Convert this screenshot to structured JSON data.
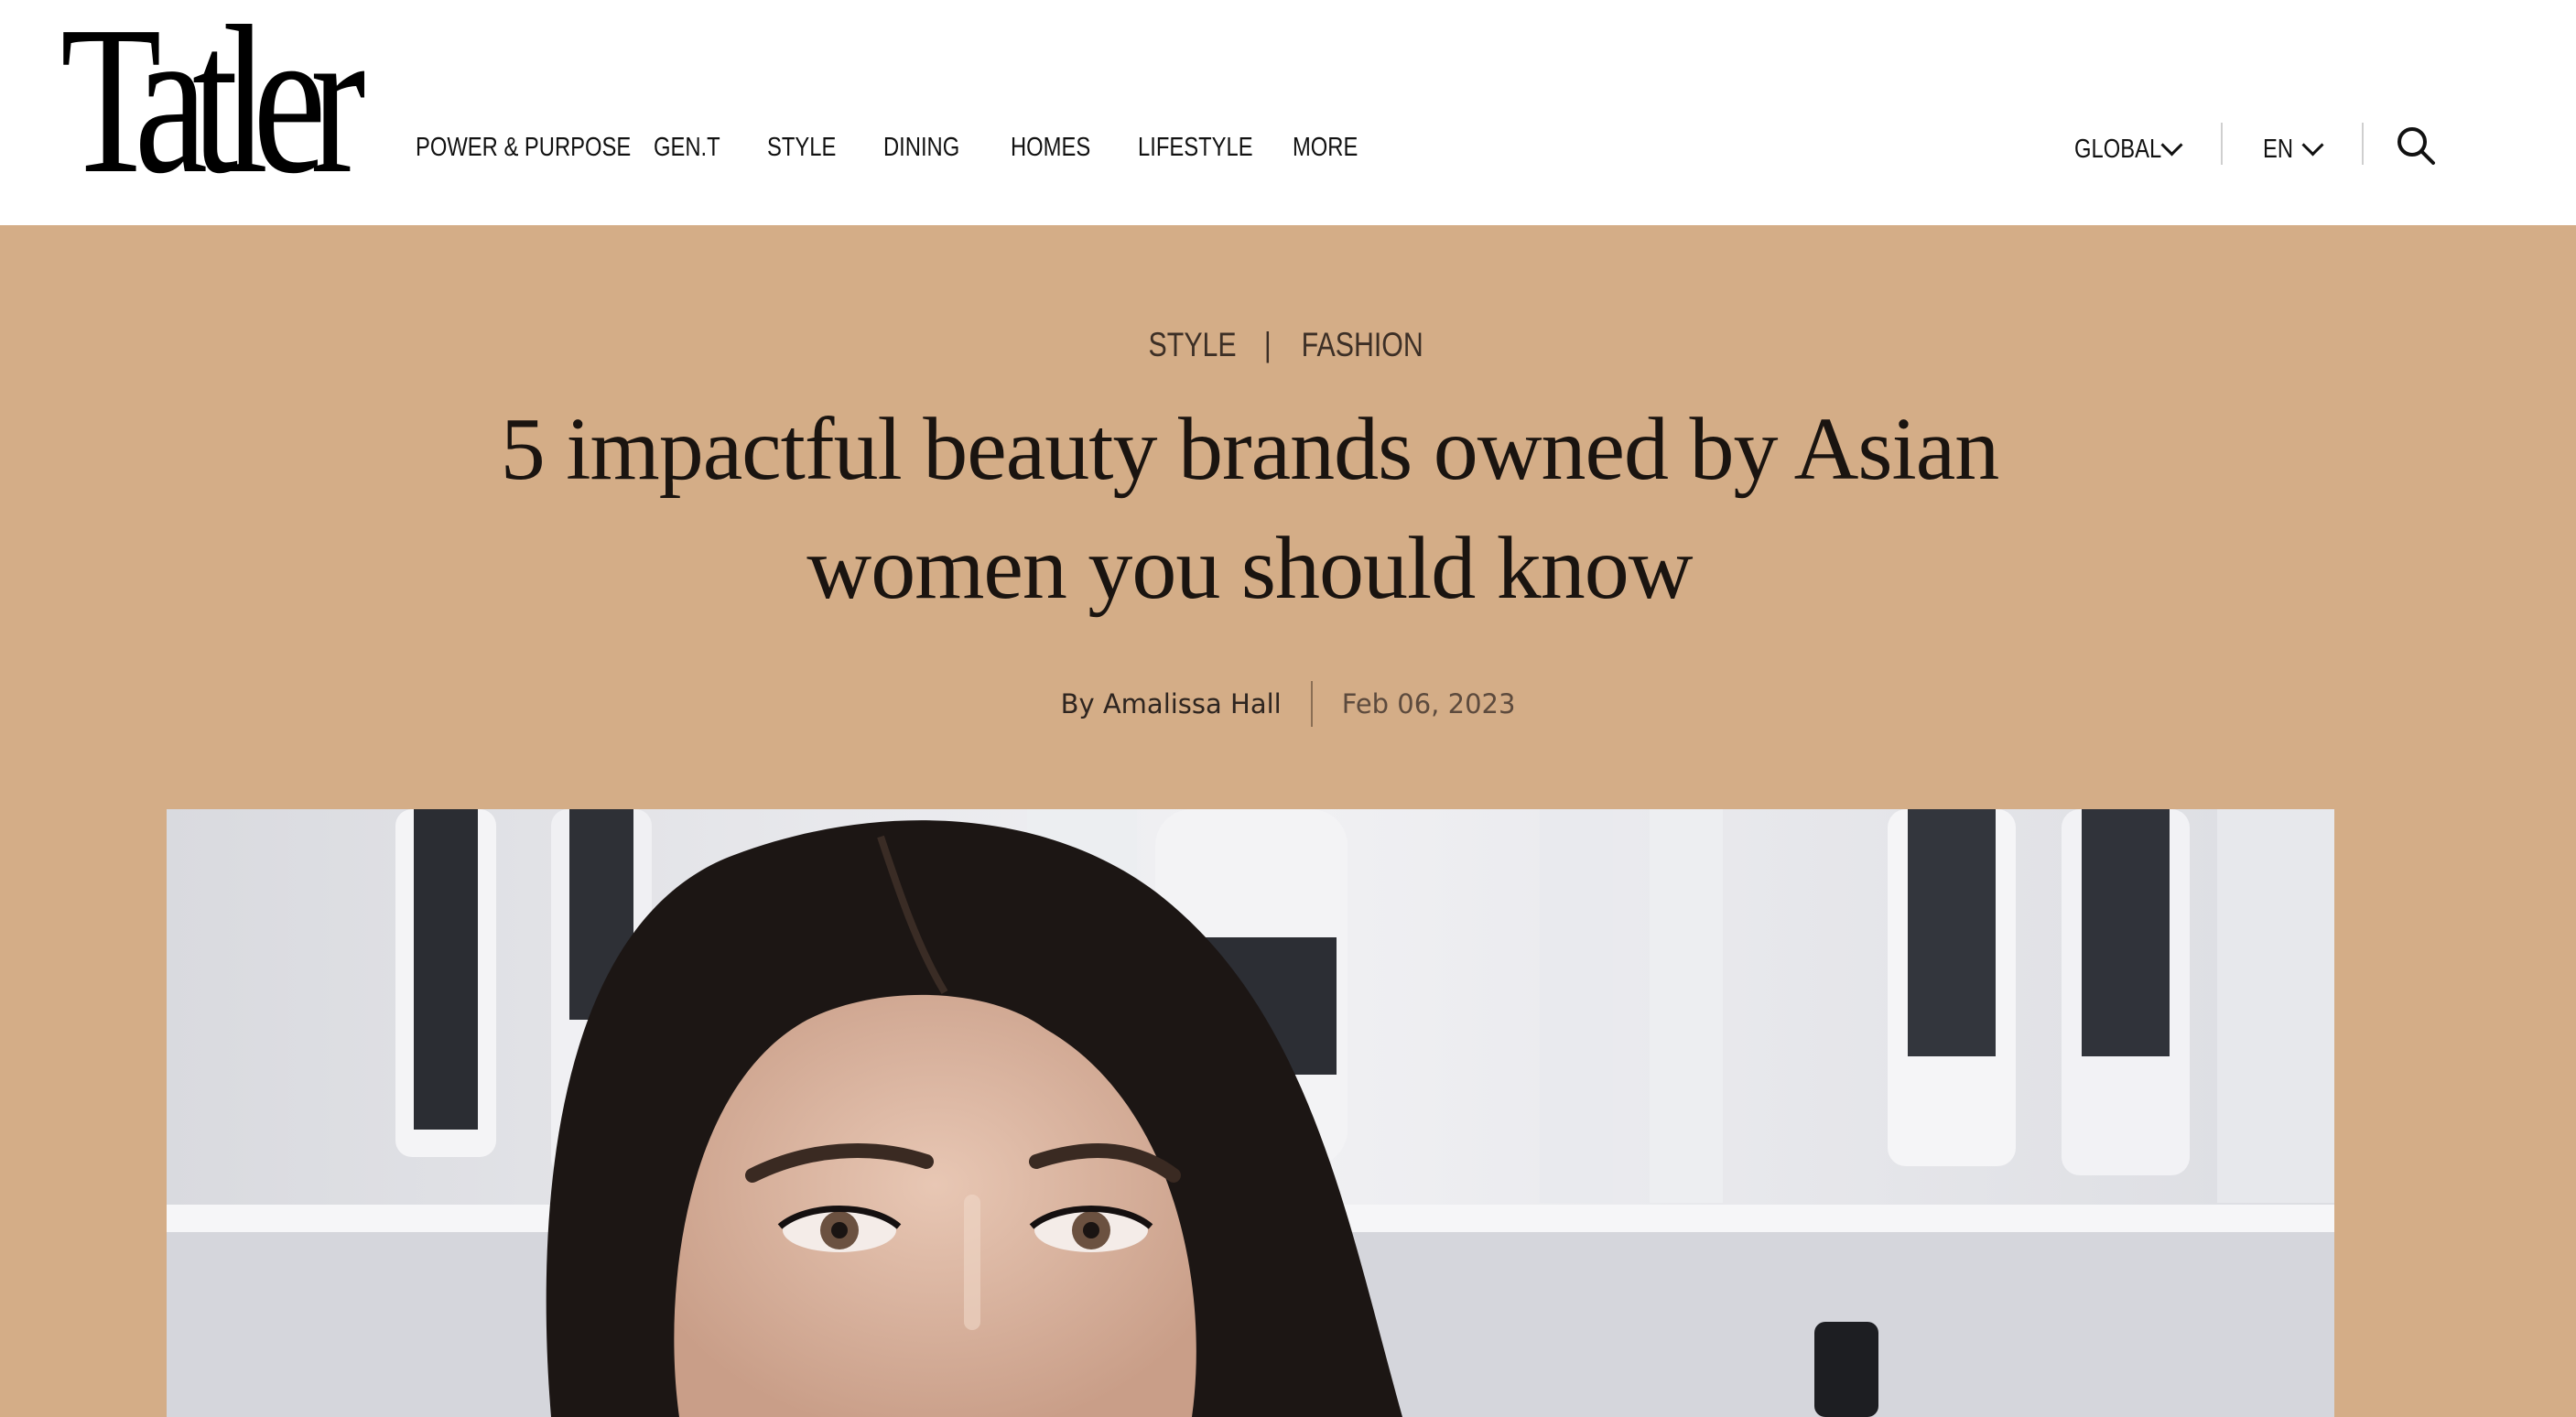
{
  "brand": {
    "logo_text": "Tatler"
  },
  "nav": {
    "items": [
      {
        "label": "POWER & PURPOSE"
      },
      {
        "label": "GEN.T"
      },
      {
        "label": "STYLE"
      },
      {
        "label": "DINING"
      },
      {
        "label": "HOMES"
      },
      {
        "label": "LIFESTYLE"
      },
      {
        "label": "MORE"
      }
    ]
  },
  "tools": {
    "region_label": "GLOBAL",
    "language_label": "EN",
    "search_icon": "search-icon",
    "chevron_icon": "chevron-down-icon"
  },
  "article": {
    "categories": [
      "STYLE",
      "FASHION"
    ],
    "category_separator": "|",
    "title_line1": "5 impactful beauty brands owned by Asian",
    "title_line2": "women you should know",
    "author": "By Amalissa Hall",
    "date": "Feb 06, 2023"
  },
  "colors": {
    "hero_background": "#d4ad87",
    "header_background": "#ffffff",
    "text_dark": "#1a1410"
  },
  "hero_image": {
    "subject": "woman-portrait-photo"
  }
}
